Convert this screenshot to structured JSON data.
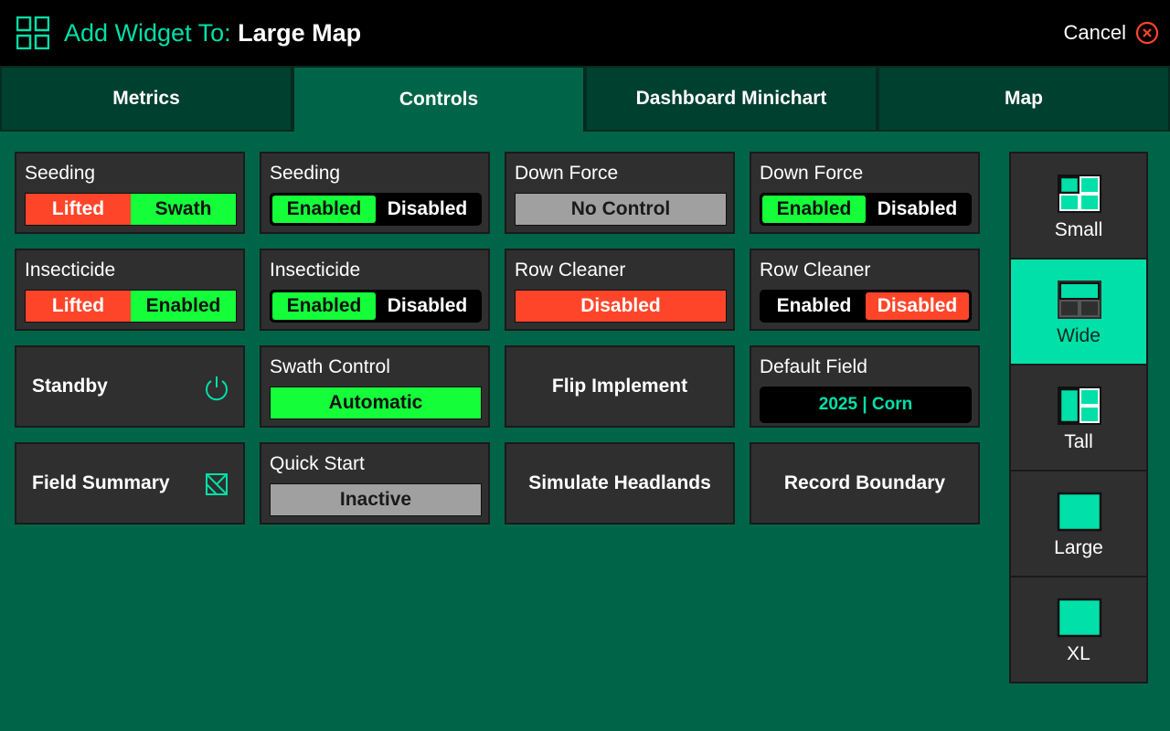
{
  "header": {
    "title_prefix": "Add Widget To:",
    "title_target": "Large Map",
    "cancel_label": "Cancel",
    "icon": "grid-icon",
    "accent_color": "#00e0a8"
  },
  "tabs": [
    {
      "label": "Metrics",
      "active": false
    },
    {
      "label": "Controls",
      "active": true
    },
    {
      "label": "Dashboard Minichart",
      "active": false
    },
    {
      "label": "Map",
      "active": false
    }
  ],
  "widgets": {
    "seeding_lifted": {
      "title": "Seeding",
      "left": "Lifted",
      "right": "Swath"
    },
    "seeding_enabled": {
      "title": "Seeding",
      "left": "Enabled",
      "right": "Disabled"
    },
    "downforce_nocontrol": {
      "title": "Down Force",
      "value": "No Control"
    },
    "downforce_enabled": {
      "title": "Down Force",
      "left": "Enabled",
      "right": "Disabled"
    },
    "insecticide_lifted": {
      "title": "Insecticide",
      "left": "Lifted",
      "right": "Enabled"
    },
    "insecticide_enabled": {
      "title": "Insecticide",
      "left": "Enabled",
      "right": "Disabled"
    },
    "rowcleaner_disabled": {
      "title": "Row Cleaner",
      "value": "Disabled"
    },
    "rowcleaner_toggle": {
      "title": "Row Cleaner",
      "left": "Enabled",
      "right": "Disabled"
    },
    "standby": {
      "label": "Standby",
      "icon": "power-icon"
    },
    "swath_control": {
      "title": "Swath Control",
      "value": "Automatic"
    },
    "flip_implement": {
      "label": "Flip Implement"
    },
    "default_field": {
      "title": "Default Field",
      "year": "2025",
      "separator": "|",
      "crop": "Corn"
    },
    "field_summary": {
      "label": "Field Summary",
      "icon": "field-summary-icon"
    },
    "quick_start": {
      "title": "Quick Start",
      "value": "Inactive"
    },
    "simulate_headlands": {
      "label": "Simulate Headlands"
    },
    "record_boundary": {
      "label": "Record Boundary"
    }
  },
  "sizes": [
    {
      "label": "Small",
      "icon": "size-small-icon",
      "active": false
    },
    {
      "label": "Wide",
      "icon": "size-wide-icon",
      "active": true
    },
    {
      "label": "Tall",
      "icon": "size-tall-icon",
      "active": false
    },
    {
      "label": "Large",
      "icon": "size-large-icon",
      "active": false
    },
    {
      "label": "XL",
      "icon": "size-xl-icon",
      "active": false
    }
  ],
  "colors": {
    "background": "#006548",
    "tab_inactive": "#00402e",
    "card": "#2f2f2f",
    "red": "#ff4529",
    "green": "#14ff3a",
    "gray": "#a0a0a0",
    "teal": "#00e0a8"
  }
}
